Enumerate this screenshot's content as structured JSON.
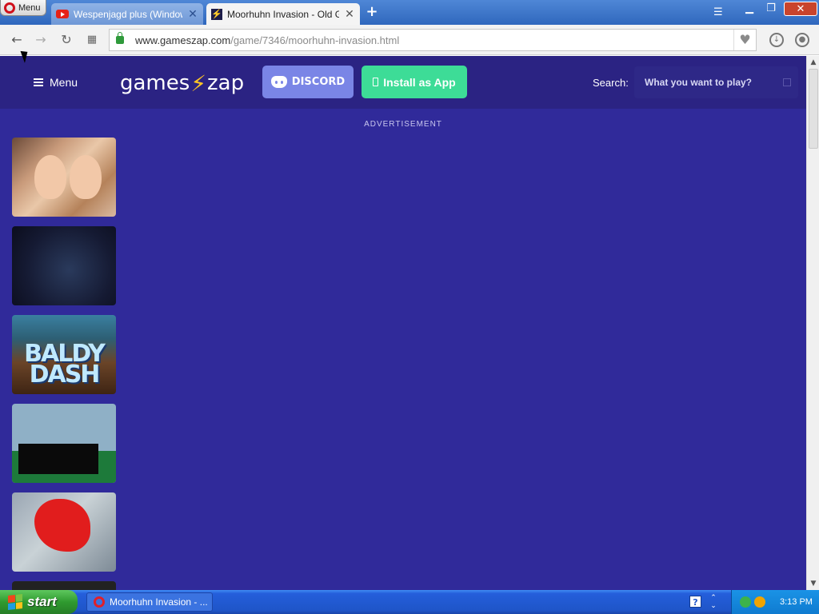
{
  "browser": {
    "menu_label": "Menu",
    "tabs": [
      {
        "title": "Wespenjagd plus (Windows",
        "icon": "youtube-icon",
        "active": false
      },
      {
        "title": "Moorhuhn Invasion - Old Gam",
        "icon": "gameszap-icon",
        "active": true
      }
    ],
    "url_host": "www.gameszap.com",
    "url_path": "/game/7346/moorhuhn-invasion.html",
    "nav_icons": [
      "back-arrow-icon",
      "forward-arrow-icon",
      "reload-icon",
      "speed-dial-icon"
    ],
    "toolbar_icons": [
      "heart-icon",
      "download-icon",
      "account-icon"
    ]
  },
  "site": {
    "menu_label": "Menu",
    "logo_left": "games",
    "logo_bolt": "⚡",
    "logo_right": "zap",
    "discord_label": "DISCORD",
    "install_label": "Install as App",
    "search_label": "Search:",
    "search_placeholder": "What you want to play?",
    "ad_label": "ADVERTISEMENT",
    "colors": {
      "background": "#302a9a",
      "header": "#2b2383",
      "discord": "#7a85e6",
      "install": "#3ddc97"
    }
  },
  "game_thumbnails": [
    {
      "name": "game-thumb-1"
    },
    {
      "name": "game-thumb-2"
    },
    {
      "name": "game-thumb-3",
      "text": "BALDY DASH"
    },
    {
      "name": "game-thumb-4"
    },
    {
      "name": "game-thumb-5"
    },
    {
      "name": "game-thumb-6"
    }
  ],
  "taskbar": {
    "start_label": "start",
    "task_item_label": "Moorhuhn Invasion - ...",
    "clock": "3:13 PM"
  }
}
